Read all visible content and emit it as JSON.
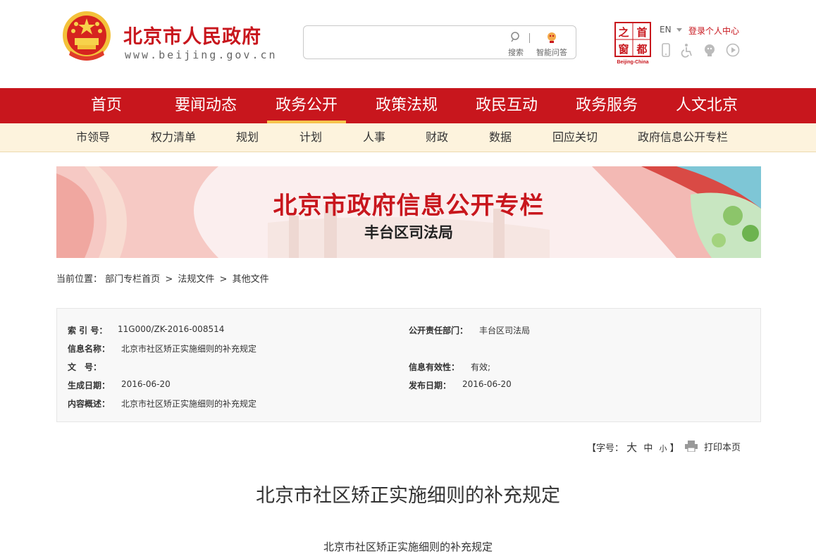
{
  "header": {
    "site_title": "北京市人民政府",
    "site_url": "www.beijing.gov.cn",
    "search": {
      "placeholder": "",
      "search_label": "搜索",
      "qa_label": "智能问答"
    },
    "capital_seal": {
      "chars": [
        "之",
        "首",
        "都",
        "窗"
      ],
      "caption": "Beijing-China"
    },
    "lang": "EN",
    "login": "登录个人中心",
    "tool_icons": [
      "mobile-icon",
      "accessibility-icon",
      "elderly-care-icon",
      "play-icon"
    ]
  },
  "nav_main": [
    "首页",
    "要闻动态",
    "政务公开",
    "政策法规",
    "政民互动",
    "政务服务",
    "人文北京"
  ],
  "nav_main_active": "政务公开",
  "nav_sub": [
    "市领导",
    "权力清单",
    "规划",
    "计划",
    "人事",
    "财政",
    "数据",
    "回应关切",
    "政府信息公开专栏"
  ],
  "banner": {
    "title": "北京市政府信息公开专栏",
    "subtitle": "丰台区司法局"
  },
  "breadcrumb": {
    "prefix": "当前位置：",
    "items": [
      "部门专栏首页",
      "法规文件",
      "其他文件"
    ],
    "separator": ">"
  },
  "meta": {
    "index_label": "索 引 号：",
    "index_value": "11G000/ZK-2016-008514",
    "dept_label": "公开责任部门：",
    "dept_value": "丰台区司法局",
    "name_label": "信息名称：",
    "name_value": "北京市社区矫正实施细则的补充规定",
    "docno_label": "文　号：",
    "docno_value": "",
    "validity_label": "信息有效性：",
    "validity_value": "有效;",
    "created_label": "生成日期：",
    "created_value": "2016-06-20",
    "published_label": "发布日期：",
    "published_value": "2016-06-20",
    "summary_label": "内容概述：",
    "summary_value": "北京市社区矫正实施细则的补充规定"
  },
  "tools": {
    "fontsize_open": "【字号：",
    "sizes": [
      "大",
      "中",
      "小"
    ],
    "fontsize_close": "】",
    "print": "打印本页"
  },
  "article": {
    "title": "北京市社区矫正实施细则的补充规定",
    "body_first_line": "北京市社区矫正实施细则的补充规定"
  },
  "colors": {
    "brand_red": "#c8161d",
    "sub_nav_bg": "#fdf3dd",
    "active_underline": "#f7c44d",
    "gold": "#f3c13a"
  }
}
